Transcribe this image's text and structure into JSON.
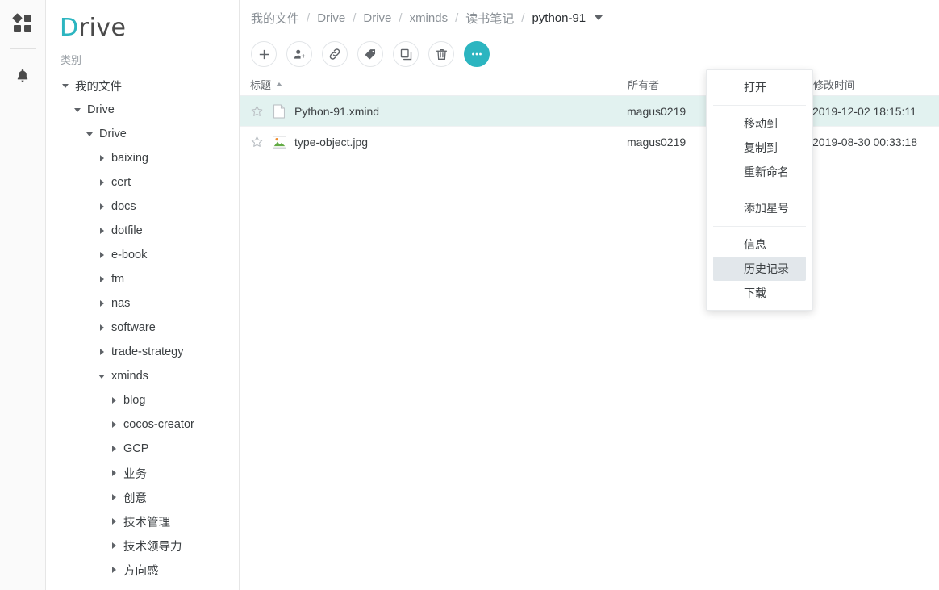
{
  "rail": {
    "items": [
      {
        "name": "apps-grid-icon",
        "label": "应用"
      },
      {
        "name": "bell-icon",
        "label": "通知"
      }
    ]
  },
  "sidebar": {
    "logo": {
      "first": "D",
      "rest": "rive"
    },
    "category_label": "类别",
    "tree": [
      {
        "label": "我的文件",
        "indent": 0,
        "state": "open"
      },
      {
        "label": "Drive",
        "indent": 1,
        "state": "open"
      },
      {
        "label": "Drive",
        "indent": 2,
        "state": "open"
      },
      {
        "label": "baixing",
        "indent": 3,
        "state": "closed"
      },
      {
        "label": "cert",
        "indent": 3,
        "state": "closed"
      },
      {
        "label": "docs",
        "indent": 3,
        "state": "closed"
      },
      {
        "label": "dotfile",
        "indent": 3,
        "state": "closed"
      },
      {
        "label": "e-book",
        "indent": 3,
        "state": "closed"
      },
      {
        "label": "fm",
        "indent": 3,
        "state": "closed"
      },
      {
        "label": "nas",
        "indent": 3,
        "state": "closed"
      },
      {
        "label": "software",
        "indent": 3,
        "state": "closed"
      },
      {
        "label": "trade-strategy",
        "indent": 3,
        "state": "closed"
      },
      {
        "label": "xminds",
        "indent": 3,
        "state": "open"
      },
      {
        "label": "blog",
        "indent": 4,
        "state": "closed"
      },
      {
        "label": "cocos-creator",
        "indent": 4,
        "state": "closed"
      },
      {
        "label": "GCP",
        "indent": 4,
        "state": "closed"
      },
      {
        "label": "业务",
        "indent": 4,
        "state": "closed"
      },
      {
        "label": "创意",
        "indent": 4,
        "state": "closed"
      },
      {
        "label": "技术管理",
        "indent": 4,
        "state": "closed"
      },
      {
        "label": "技术领导力",
        "indent": 4,
        "state": "closed"
      },
      {
        "label": "方向感",
        "indent": 4,
        "state": "closed"
      }
    ]
  },
  "breadcrumb": {
    "items": [
      {
        "label": "我的文件",
        "active": false
      },
      {
        "label": "Drive",
        "active": false
      },
      {
        "label": "Drive",
        "active": false
      },
      {
        "label": "xminds",
        "active": false
      },
      {
        "label": "读书笔记",
        "active": false
      },
      {
        "label": "python-91",
        "active": true
      }
    ],
    "separator": "/"
  },
  "toolbar": {
    "buttons": [
      {
        "name": "new-button",
        "icon": "plus-icon",
        "label": "新建",
        "active": false
      },
      {
        "name": "share-button",
        "icon": "person-add-icon",
        "label": "共享",
        "active": false
      },
      {
        "name": "link-button",
        "icon": "link-icon",
        "label": "链接",
        "active": false
      },
      {
        "name": "tag-button",
        "icon": "tag-icon",
        "label": "标签",
        "active": false
      },
      {
        "name": "copy-button",
        "icon": "copy-icon",
        "label": "复制",
        "active": false
      },
      {
        "name": "delete-button",
        "icon": "trash-icon",
        "label": "删除",
        "active": false
      },
      {
        "name": "more-button",
        "icon": "ellipsis-icon",
        "label": "更多",
        "active": true
      }
    ]
  },
  "table": {
    "columns": [
      {
        "key": "title",
        "label": "标题",
        "sort": "asc"
      },
      {
        "key": "owner",
        "label": "所有者",
        "sort": ""
      },
      {
        "key": "modified",
        "label": "修改时间",
        "sort": ""
      }
    ],
    "rows": [
      {
        "title": "Python-91.xmind",
        "owner": "magus0219",
        "modified": "2019-12-02 18:15:11",
        "icon": "file-icon",
        "starred": false,
        "selected": true
      },
      {
        "title": "type-object.jpg",
        "owner": "magus0219",
        "modified": "2019-08-30 00:33:18",
        "icon": "image-icon",
        "starred": false,
        "selected": false
      }
    ]
  },
  "context_menu": {
    "groups": [
      [
        {
          "label": "打开",
          "highlighted": false
        }
      ],
      [
        {
          "label": "移动到",
          "highlighted": false
        },
        {
          "label": "复制到",
          "highlighted": false
        },
        {
          "label": "重新命名",
          "highlighted": false
        }
      ],
      [
        {
          "label": "添加星号",
          "highlighted": false
        }
      ],
      [
        {
          "label": "信息",
          "highlighted": false
        },
        {
          "label": "历史记录",
          "highlighted": true
        },
        {
          "label": "下载",
          "highlighted": false
        }
      ]
    ]
  },
  "colors": {
    "accent": "#2cb5c0",
    "selected_row": "#e2f2f0",
    "menu_highlight": "#e2e7eb",
    "text": "#3c4043",
    "muted": "#8a9096"
  }
}
